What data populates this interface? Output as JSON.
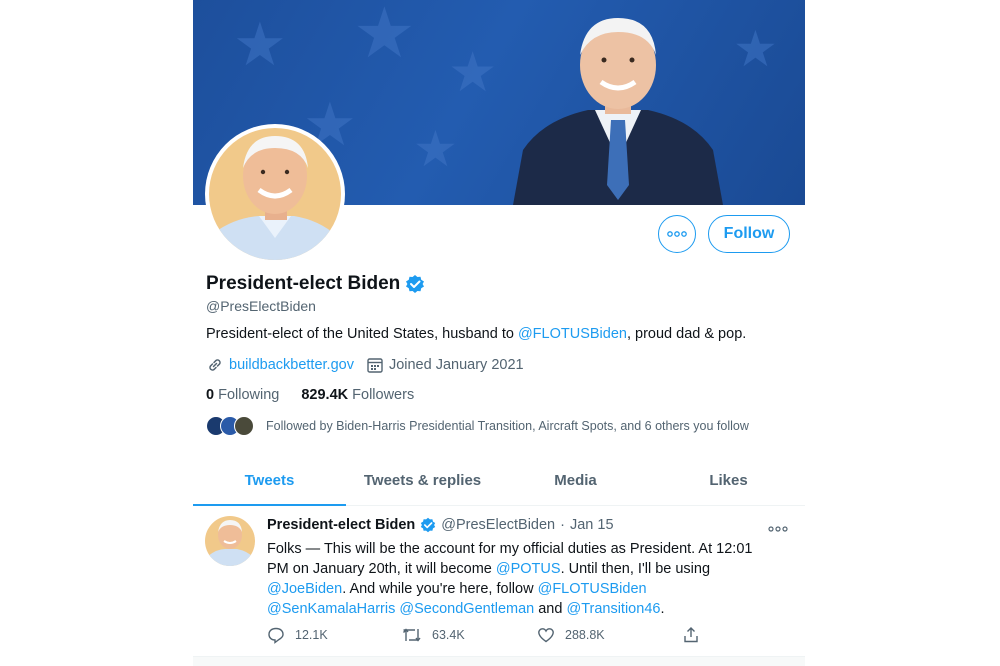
{
  "profile": {
    "display_name": "President-elect Biden",
    "handle": "@PresElectBiden",
    "bio_prefix": "President-elect of the United States, husband to ",
    "bio_mention": "@FLOTUSBiden",
    "bio_suffix": ", proud dad & pop.",
    "website": "buildbackbetter.gov",
    "joined": "Joined January 2021",
    "following_count": "0",
    "following_label": "Following",
    "followers_count": "829.4K",
    "followers_label": "Followers",
    "followed_by": "Followed by Biden-Harris Presidential Transition, Aircraft Spots, and 6 others you follow",
    "follow_label": "Follow"
  },
  "tabs": [
    {
      "label": "Tweets",
      "active": true
    },
    {
      "label": "Tweets & replies",
      "active": false
    },
    {
      "label": "Media",
      "active": false
    },
    {
      "label": "Likes",
      "active": false
    }
  ],
  "tweet": {
    "name": "President-elect Biden",
    "handle": "@PresElectBiden",
    "separator": "·",
    "date": "Jan 15",
    "line1": "Folks — This will be the account for my official duties as President. At 12:01",
    "line2_prefix": "PM on January 20th, it will become ",
    "line2_mention": "@POTUS",
    "line2_suffix": ". Until then, I'll be using",
    "line3_mention": "@JoeBiden",
    "line3_middle": ". And while you're here, follow ",
    "line3_mention2": "@FLOTUSBiden",
    "line4_mention1": "@SenKamalaHarris",
    "line4_mention2": "@SecondGentleman",
    "line4_and": " and ",
    "line4_mention3": "@Transition46",
    "line4_end": ".",
    "replies": "12.1K",
    "retweets": "63.4K",
    "likes": "288.8K"
  },
  "colors": {
    "accent": "#1d9bf0",
    "banner": "#1d4f9c",
    "text": "#0f1419",
    "muted": "#536471"
  }
}
